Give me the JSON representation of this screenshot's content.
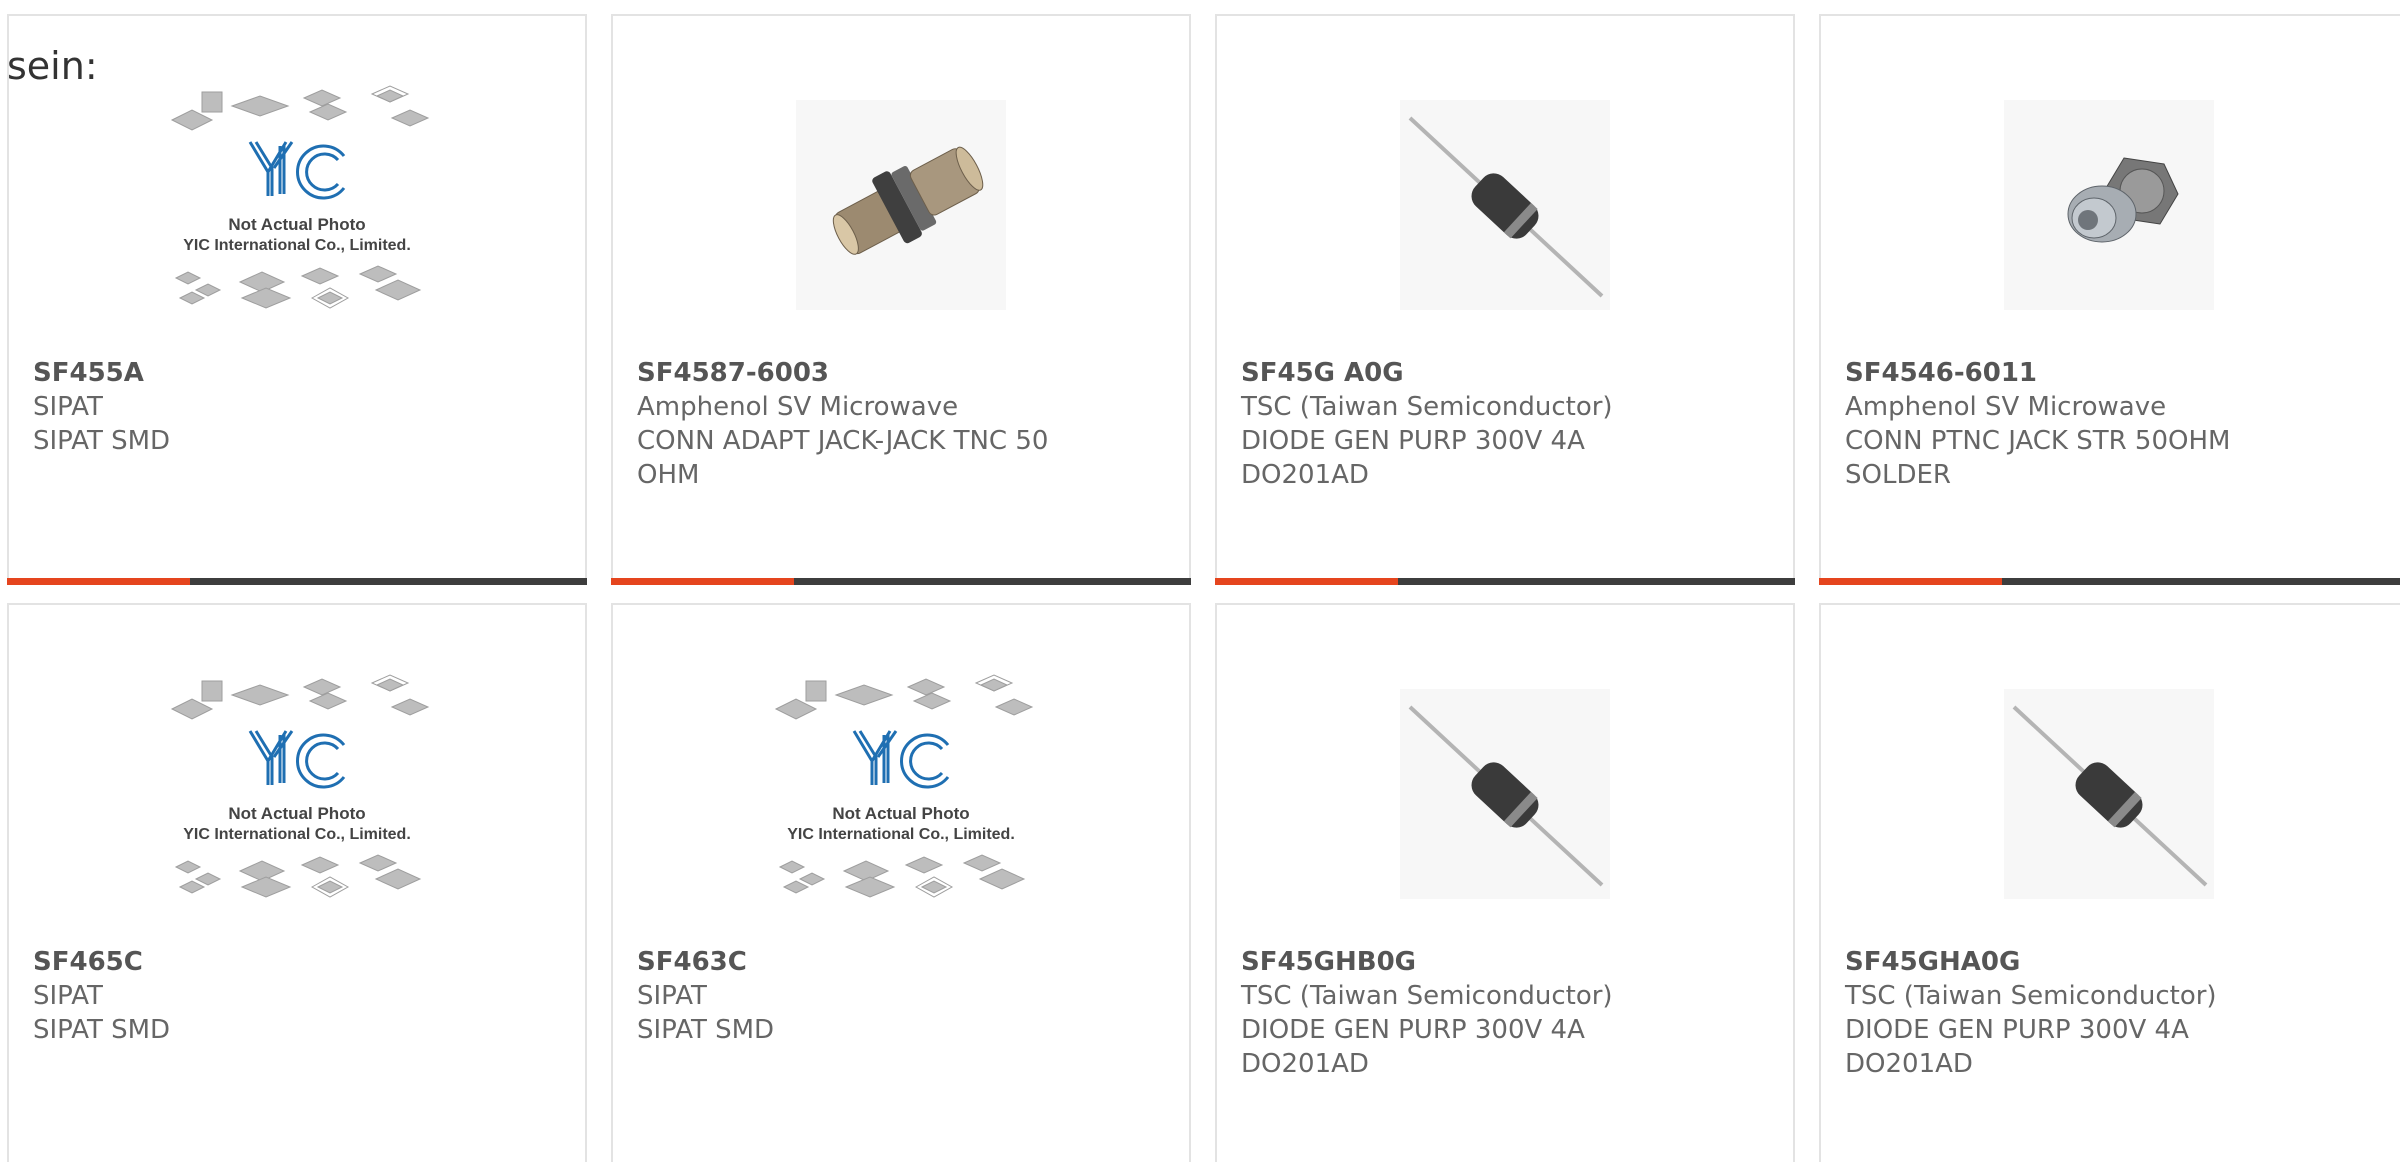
{
  "stray_text": "sein:",
  "placeholder_caption": {
    "line1": "Not Actual Photo",
    "line2": "YIC International Co., Limited.",
    "logo": "YIC"
  },
  "colors": {
    "accent": "#e5451e",
    "bar": "#3d3d3d",
    "logo_blue": "#1f6fb2",
    "border": "#e3e3e3"
  },
  "products": [
    {
      "part": "SF455A",
      "manufacturer": "SIPAT",
      "description": "SIPAT SMD",
      "image": "placeholder-photo"
    },
    {
      "part": "SF4587-6003",
      "manufacturer": "Amphenol SV Microwave",
      "description": "CONN ADAPT JACK-JACK TNC 50 OHM",
      "image": "tnc-adapter-photo"
    },
    {
      "part": "SF45G A0G",
      "manufacturer": "TSC (Taiwan Semiconductor)",
      "description": "DIODE GEN PURP 300V 4A DO201AD",
      "image": "axial-diode-photo"
    },
    {
      "part": "SF4546-6011",
      "manufacturer": "Amphenol SV Microwave",
      "description": "CONN PTNC JACK STR 50OHM SOLDER",
      "image": "ptnc-jack-photo"
    },
    {
      "part": "SF465C",
      "manufacturer": "SIPAT",
      "description": "SIPAT SMD",
      "image": "placeholder-photo"
    },
    {
      "part": "SF463C",
      "manufacturer": "SIPAT",
      "description": "SIPAT SMD",
      "image": "placeholder-photo"
    },
    {
      "part": "SF45GHB0G",
      "manufacturer": "TSC (Taiwan Semiconductor)",
      "description": "DIODE GEN PURP 300V 4A DO201AD",
      "image": "axial-diode-photo"
    },
    {
      "part": "SF45GHA0G",
      "manufacturer": "TSC (Taiwan Semiconductor)",
      "description": "DIODE GEN PURP 300V 4A DO201AD",
      "image": "axial-diode-photo"
    }
  ]
}
